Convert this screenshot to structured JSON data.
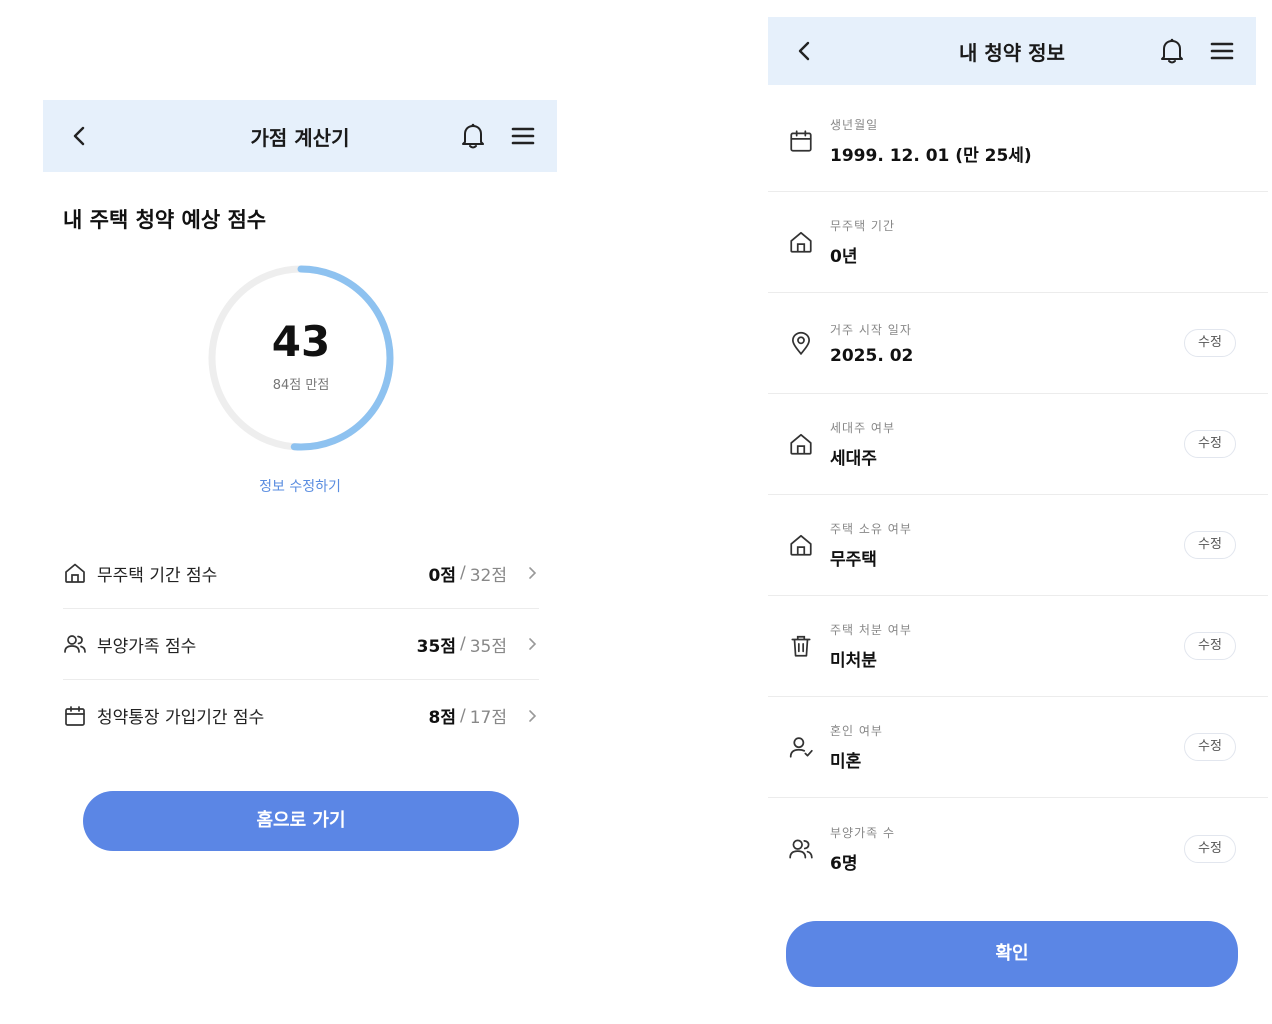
{
  "left": {
    "header": {
      "title": "가점 계산기"
    },
    "section_title": "내 주택 청약 예상 점수",
    "gauge": {
      "score": "43",
      "max_label": "84점 만점",
      "score_value": 43,
      "score_max": 84
    },
    "edit_link": "정보 수정하기",
    "rows": [
      {
        "label": "무주택 기간 점수",
        "value": "0점",
        "sep": "/",
        "max": "32점",
        "icon": "home-icon"
      },
      {
        "label": "부양가족 점수",
        "value": "35점",
        "sep": "/",
        "max": "35점",
        "icon": "people-icon"
      },
      {
        "label": "청약통장 가입기간 점수",
        "value": "8점",
        "sep": "/",
        "max": "17점",
        "icon": "calendar-icon"
      }
    ],
    "home_button": "홈으로 가기"
  },
  "right": {
    "header": {
      "title": "내 청약 정보"
    },
    "rows": [
      {
        "label": "생년월일",
        "value": "1999. 12. 01 (만 25세)",
        "icon": "calendar-icon",
        "edit": ""
      },
      {
        "label": "무주택 기간",
        "value": "0년",
        "icon": "home-icon",
        "edit": ""
      },
      {
        "label": "거주 시작 일자",
        "value": "2025. 02",
        "icon": "location-pin-icon",
        "edit": "수정"
      },
      {
        "label": "세대주 여부",
        "value": "세대주",
        "icon": "home-icon",
        "edit": "수정"
      },
      {
        "label": "주택 소유 여부",
        "value": "무주택",
        "icon": "home-icon",
        "edit": "수정"
      },
      {
        "label": "주택 처분 여부",
        "value": "미처분",
        "icon": "trash-icon",
        "edit": "수정"
      },
      {
        "label": "혼인 여부",
        "value": "미혼",
        "icon": "person-check-icon",
        "edit": "수정"
      },
      {
        "label": "부양가족 수",
        "value": "6명",
        "icon": "people-icon",
        "edit": "수정"
      }
    ],
    "confirm_button": "확인"
  },
  "colors": {
    "appbar_bg": "#e6f0fb",
    "primary": "#5b86e5",
    "gauge_fill": "#8ec2f0",
    "gauge_track": "#eeeeee",
    "link": "#5a8de0"
  }
}
